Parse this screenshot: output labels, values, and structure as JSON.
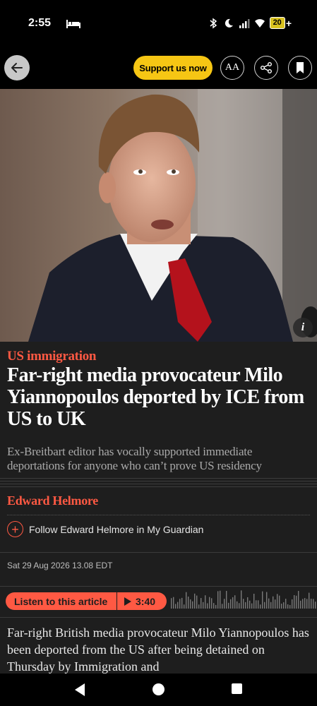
{
  "status_bar": {
    "time": "2:55",
    "battery": "20",
    "icons": [
      "bed-icon",
      "bluetooth-icon",
      "moon-icon",
      "signal-icon",
      "wifi-icon",
      "battery-icon"
    ]
  },
  "app_bar": {
    "support_label": "Support us now",
    "text_size_label": "AA"
  },
  "article": {
    "kicker": "US immigration",
    "headline": "Far-right media provocateur Milo Yiannopoulos deported by ICE from US to UK",
    "standfirst": "Ex-Breitbart editor has vocally supported immediate deportations for anyone who can’t prove US residency",
    "byline": "Edward Helmore",
    "follow_label": "Follow Edward Helmore in My Guardian",
    "dateline": "Sat 29 Aug 2026 13.08 EDT",
    "audio": {
      "label": "Listen to this article",
      "duration": "3:40"
    },
    "body": "Far-right British media provocateur Milo Yiannopoulos has been deported from the US after being detained on Thursday by Immigration and"
  },
  "colors": {
    "accent": "#ff5943",
    "support_button": "#f6c614",
    "article_background": "#1e1e1e"
  }
}
